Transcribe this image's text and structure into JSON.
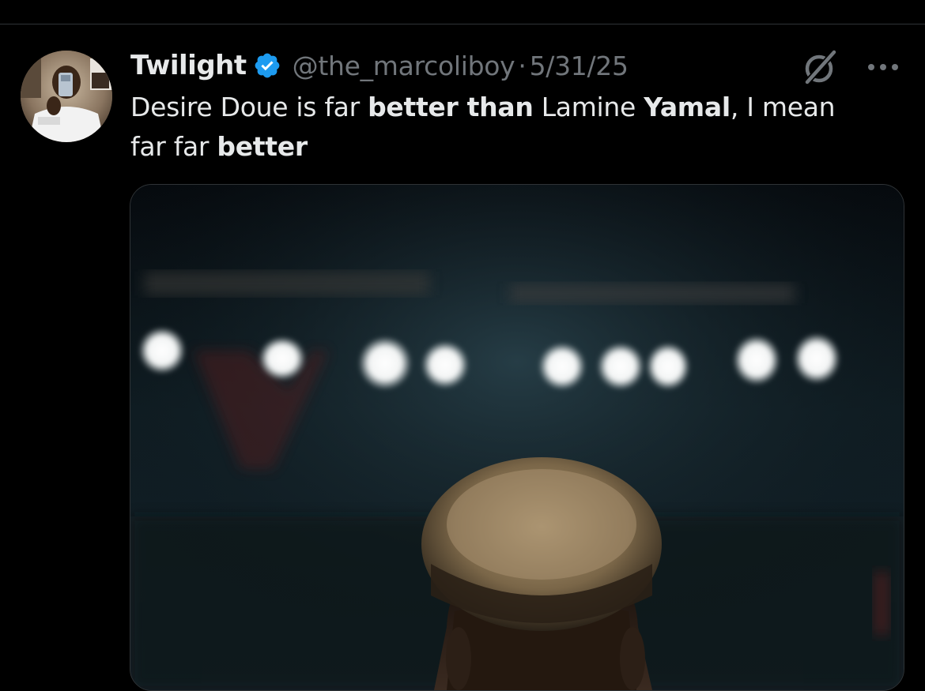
{
  "post": {
    "author": {
      "display_name": "Twilight",
      "handle": "@the_marcoliboy",
      "verified": true,
      "avatar_icon": "profile-photo"
    },
    "separator": "·",
    "date": "5/31/25",
    "text": {
      "line1_part1": "Desire Doue  is far ",
      "line1_bold1": "better than",
      "line1_part2": " Lamine ",
      "line1_bold2": "Yamal",
      "line1_part3": ", I mean",
      "line2_part1": "far far ",
      "line2_bold1": "better"
    },
    "actions": {
      "grok_icon": "grok-icon",
      "more_icon": "more-options-icon"
    },
    "media": {
      "description_icon": "photo"
    }
  },
  "colors": {
    "background": "#000000",
    "text_primary": "#e7e9ea",
    "text_secondary": "#71767b",
    "verified_blue": "#1d9bf0",
    "divider": "#2f3336"
  }
}
